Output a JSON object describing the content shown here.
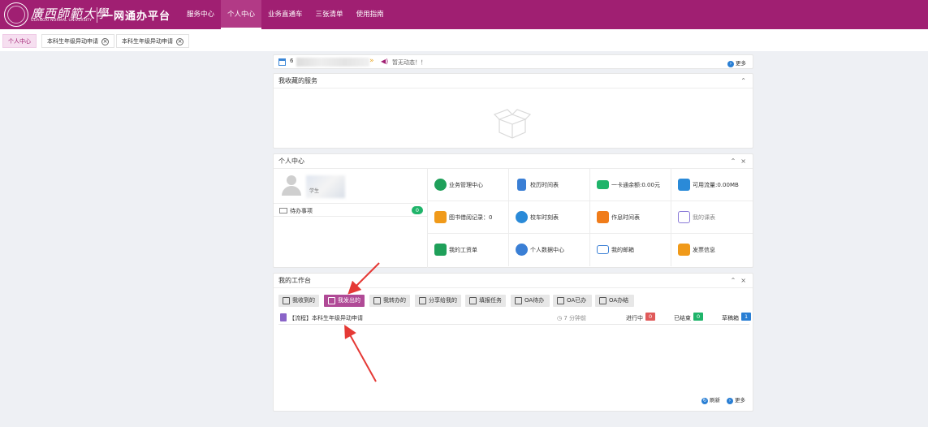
{
  "header": {
    "logo_text": "廣西師範大學",
    "logo_sub": "GUANGXI NORMAL UNIVERSITY",
    "platform": "一网通办平台",
    "nav": [
      "服务中心",
      "个人中心",
      "业务直通车",
      "三张清单",
      "使用指南"
    ],
    "active_nav": "个人中心"
  },
  "tabs": [
    {
      "label": "个人中心",
      "active": true,
      "closable": false
    },
    {
      "label": "本科生年级异动申请",
      "active": false,
      "closable": true
    },
    {
      "label": "本科生年级异动申请",
      "active": false,
      "closable": true
    }
  ],
  "infobar": {
    "date_prefix": "6",
    "notice": "暂无动态！！",
    "more": "更多"
  },
  "favorites": {
    "title": "我收藏的服务"
  },
  "personal": {
    "title": "个人中心",
    "name_fragment": "学生",
    "todo_label": "待办事项",
    "todo_count": "0",
    "cells": [
      {
        "label": "业务管理中心",
        "icon": "service-icon",
        "color": "#1fa05a"
      },
      {
        "label": "校历时间表",
        "icon": "calendar-icon",
        "color": "#3a7fd5"
      },
      {
        "label": "一卡通余额:0.00元",
        "icon": "card-icon",
        "color": "#1fb46a"
      },
      {
        "label": "可用流量:0.00MB",
        "icon": "download-icon",
        "color": "#2a8ad8"
      },
      {
        "label": "图书借阅记录：0",
        "icon": "book-icon",
        "color": "#f09a1a"
      },
      {
        "label": "校车时刻表",
        "icon": "bus-icon",
        "color": "#2a8ad8"
      },
      {
        "label": "作息时间表",
        "icon": "clock-icon",
        "color": "#f07c1a"
      },
      {
        "label": "我的课表",
        "icon": "timetable-icon",
        "color": "#8a7ad8"
      },
      {
        "label": "我的工资单",
        "icon": "salary-icon",
        "color": "#1fa05a"
      },
      {
        "label": "个人数据中心",
        "icon": "user-data-icon",
        "color": "#3a7fd5"
      },
      {
        "label": "我的邮箱",
        "icon": "mail-icon",
        "color": "#3a7fd5"
      },
      {
        "label": "发票信息",
        "icon": "invoice-icon",
        "color": "#f09a1a"
      }
    ]
  },
  "workbench": {
    "title": "我的工作台",
    "tabs": [
      "我收到的",
      "我发出的",
      "我转办的",
      "分享给我的",
      "填报任务",
      "OA待办",
      "OA已办",
      "OA办结"
    ],
    "active_tab": "我发出的",
    "rows": [
      {
        "title": "【流程】本科生年级异动申请",
        "time": "7 分钟前",
        "in_progress_label": "进行中",
        "in_progress": "0",
        "done_label": "已结束",
        "done": "0",
        "draft_label": "草稿箱",
        "draft": "1"
      }
    ],
    "refresh": "刷新",
    "more": "更多"
  },
  "colors": {
    "brand": "#a01f72",
    "accent_tab": "#b04a96",
    "annotation": "#e53935"
  }
}
